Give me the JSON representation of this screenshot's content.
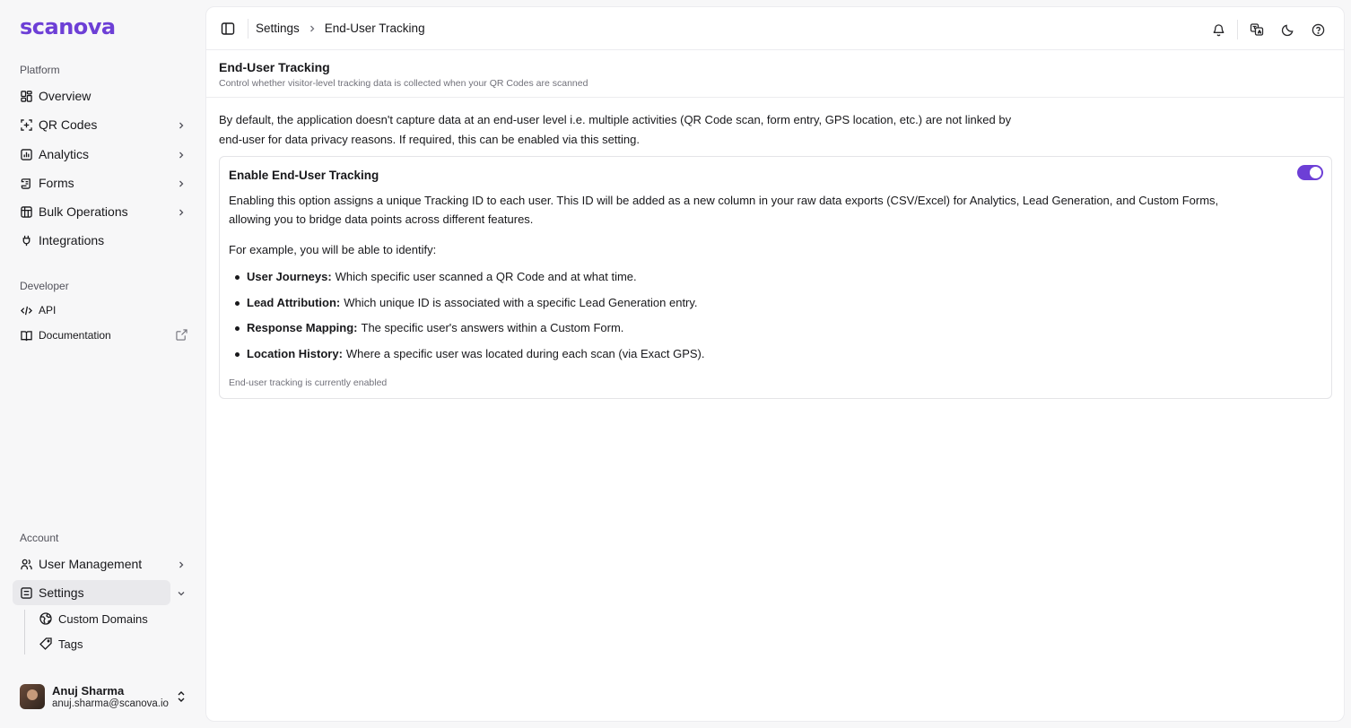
{
  "brand": {
    "logo_text": "scanova",
    "accent": "#6d3fd6"
  },
  "sidebar": {
    "platform_label": "Platform",
    "platform_items": [
      {
        "label": "Overview",
        "icon": "overview-grid-icon"
      },
      {
        "label": "QR Codes",
        "icon": "qr-code-icon"
      },
      {
        "label": "Analytics",
        "icon": "bar-chart-icon"
      },
      {
        "label": "Forms",
        "icon": "form-scroll-icon"
      },
      {
        "label": "Bulk Operations",
        "icon": "package-icon"
      },
      {
        "label": "Integrations",
        "icon": "plug-icon"
      }
    ],
    "developer_label": "Developer",
    "developer_items": [
      {
        "label": "API",
        "icon": "code-icon"
      },
      {
        "label": "Documentation",
        "icon": "book-icon"
      }
    ],
    "account_label": "Account",
    "account_items": [
      {
        "label": "User Management",
        "icon": "users-icon"
      },
      {
        "label": "Settings",
        "icon": "settings-panel-icon"
      }
    ],
    "settings_sub": [
      {
        "label": "Custom Domains",
        "icon": "globe-icon"
      },
      {
        "label": "Tags",
        "icon": "tag-icon"
      }
    ],
    "user": {
      "name": "Anuj Sharma",
      "email": "anuj.sharma@scanova.io"
    }
  },
  "topbar": {
    "breadcrumb_parent": "Settings",
    "breadcrumb_current": "End-User Tracking"
  },
  "page": {
    "title": "End-User Tracking",
    "subtitle": "Control whether visitor-level tracking data is collected when your QR Codes are scanned",
    "intro_line1": "By default, the application doesn't capture data at an end-user level i.e. multiple activities (QR Code scan, form entry, GPS location, etc.) are not linked by",
    "intro_line2": "end-user for data privacy reasons. If required, this can be enabled via this setting."
  },
  "card": {
    "title": "Enable End-User Tracking",
    "toggle_on": true,
    "description": "Enabling this option assigns a unique Tracking ID to each user. This ID will be added as a new column in your raw data exports (CSV/Excel) for Analytics, Lead Generation, and Custom Forms, allowing you to bridge data points across different features.",
    "example_intro": "For example, you will be able to identify:",
    "bullets": [
      {
        "term": "User Journeys:",
        "text": "Which specific user scanned a QR Code and at what time."
      },
      {
        "term": "Lead Attribution:",
        "text": "Which unique ID is associated with a specific Lead Generation entry."
      },
      {
        "term": "Response Mapping:",
        "text": "The specific user's answers within a Custom Form."
      },
      {
        "term": "Location History:",
        "text": "Where a specific user was located during each scan (via Exact GPS)."
      }
    ],
    "status": "End-user tracking is currently enabled"
  }
}
